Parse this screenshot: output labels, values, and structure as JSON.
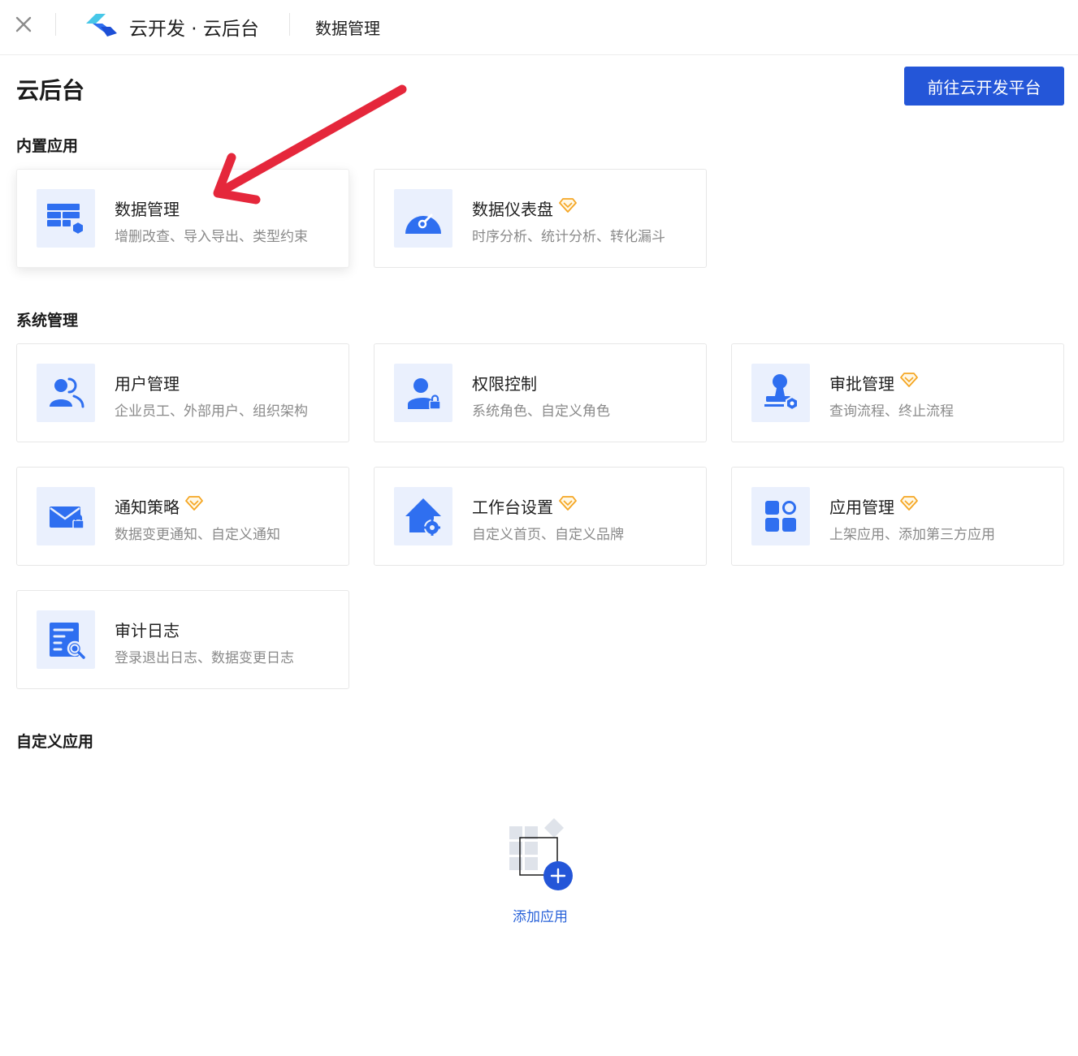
{
  "header": {
    "app_title": "云开发 · 云后台",
    "tab_label": "数据管理"
  },
  "page": {
    "title": "云后台",
    "goto_button": "前往云开发平台"
  },
  "sections": {
    "builtin": {
      "title": "内置应用",
      "cards": [
        {
          "title": "数据管理",
          "desc": "增删改查、导入导出、类型约束",
          "icon": "data-table-icon",
          "premium": false
        },
        {
          "title": "数据仪表盘",
          "desc": "时序分析、统计分析、转化漏斗",
          "icon": "gauge-icon",
          "premium": true
        }
      ]
    },
    "system": {
      "title": "系统管理",
      "cards": [
        {
          "title": "用户管理",
          "desc": "企业员工、外部用户、组织架构",
          "icon": "users-icon",
          "premium": false
        },
        {
          "title": "权限控制",
          "desc": "系统角色、自定义角色",
          "icon": "user-lock-icon",
          "premium": false
        },
        {
          "title": "审批管理",
          "desc": "查询流程、终止流程",
          "icon": "approval-stamp-icon",
          "premium": true
        },
        {
          "title": "通知策略",
          "desc": "数据变更通知、自定义通知",
          "icon": "mail-lock-icon",
          "premium": true
        },
        {
          "title": "工作台设置",
          "desc": "自定义首页、自定义品牌",
          "icon": "home-gear-icon",
          "premium": true
        },
        {
          "title": "应用管理",
          "desc": "上架应用、添加第三方应用",
          "icon": "apps-grid-icon",
          "premium": true
        },
        {
          "title": "审计日志",
          "desc": "登录退出日志、数据变更日志",
          "icon": "log-search-icon",
          "premium": false
        }
      ]
    },
    "custom": {
      "title": "自定义应用",
      "add_label": "添加应用"
    }
  },
  "colors": {
    "primary": "#2456d8",
    "icon_blue": "#2f6ff0",
    "icon_bg": "#eaf0fd",
    "premium": "#f5a623",
    "annotation_arrow": "#e5273b"
  }
}
